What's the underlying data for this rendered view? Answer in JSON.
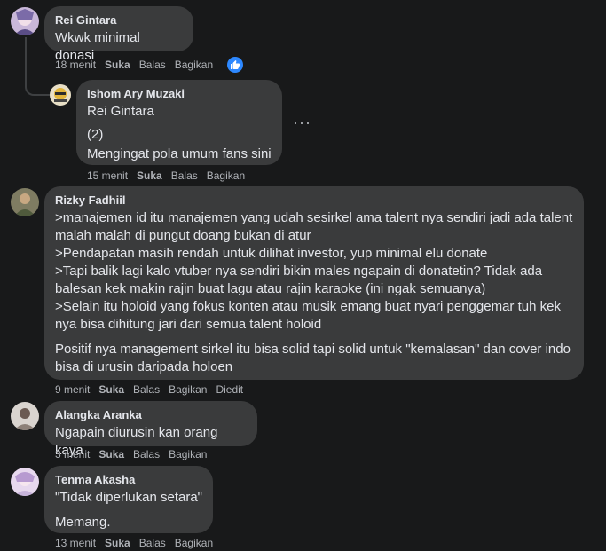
{
  "comments": {
    "c1": {
      "author": "Rei Gintara",
      "text": "Wkwk minimal donasi",
      "time": "18 menit",
      "like": "Suka",
      "reply": "Balas",
      "share": "Bagikan"
    },
    "c2": {
      "author": "Ishom Ary Muzaki",
      "mention": "Rei Gintara",
      "line1": "(2)",
      "line2": "Mengingat pola umum fans sini",
      "time": "15 menit",
      "like": "Suka",
      "reply": "Balas",
      "share": "Bagikan",
      "more": "···"
    },
    "c3": {
      "author": "Rizky Fadhiil",
      "para1": [
        ">manajemen id itu manajemen yang udah sesirkel ama talent nya sendiri jadi ada talent",
        "malah malah di pungut doang bukan di atur",
        ">Pendapatan masih rendah untuk dilihat investor, yup minimal elu donate",
        ">Tapi balik lagi kalo vtuber nya sendiri bikin males ngapain di donatetin? Tidak ada",
        "balesan kek makin rajin buat lagu atau rajin karaoke (ini ngak semuanya)",
        ">Selain itu holoid yang fokus konten atau musik emang buat nyari penggemar tuh kek",
        "nya bisa dihitung jari dari semua talent holoid"
      ],
      "para2": [
        "Positif nya management sirkel itu bisa solid tapi solid untuk \"kemalasan\" dan cover indo",
        "bisa di urusin daripada holoen"
      ],
      "time": "9 menit",
      "like": "Suka",
      "reply": "Balas",
      "share": "Bagikan",
      "edited": "Diedit"
    },
    "c4": {
      "author": "Alangka Aranka",
      "text": "Ngapain diurusin kan orang kaya",
      "time": "3 menit",
      "like": "Suka",
      "reply": "Balas",
      "share": "Bagikan"
    },
    "c5": {
      "author": "Tenma Akasha",
      "line1": "\"Tidak diperlukan setara\"",
      "line2": "Memang.",
      "time": "13 menit",
      "like": "Suka",
      "reply": "Balas",
      "share": "Bagikan"
    }
  },
  "colors": {
    "background": "#18191a",
    "bubble": "#3a3b3c",
    "text": "#e4e6eb",
    "secondary": "#b0b3b8",
    "like_badge": "#2d88ff"
  },
  "icons": {
    "like_reaction": "thumbs-up-icon",
    "more": "more-options-icon"
  }
}
